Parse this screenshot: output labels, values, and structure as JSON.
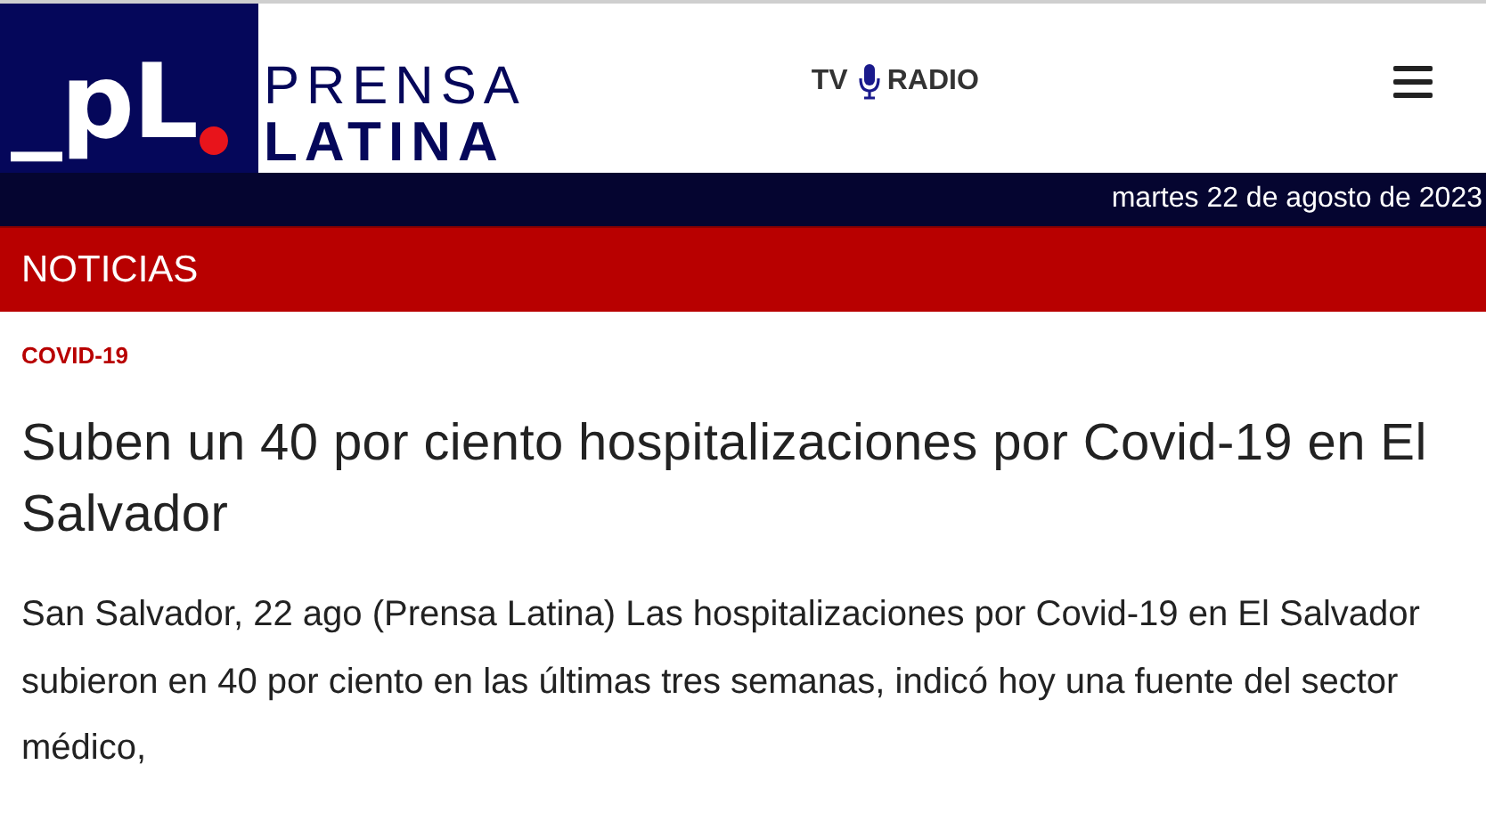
{
  "header": {
    "logo_mark": "_pL",
    "brand_top": "PRENSA",
    "brand_bottom": "LATINA",
    "links": [
      {
        "label": "TV",
        "kind": "tv"
      },
      {
        "label": "RADIO",
        "kind": "radio"
      }
    ]
  },
  "date_bar": {
    "date": "martes 22 de agosto de 2023"
  },
  "section_bar": {
    "title": "NOTICIAS"
  },
  "article": {
    "category": "COVID-19",
    "headline": "Suben un 40 por ciento hospitalizaciones por Covid-19 en El Salvador",
    "lead": "San Salvador, 22 ago (Prensa Latina) Las hospitalizaciones por Covid-19 en El Salvador subieron en 40 por ciento en las últimas tres semanas, indicó hoy una fuente del sector médico,"
  }
}
